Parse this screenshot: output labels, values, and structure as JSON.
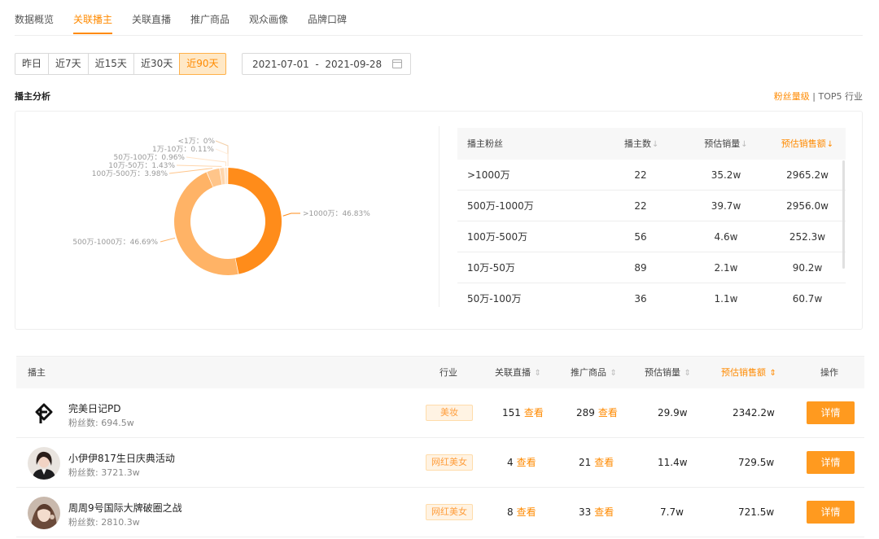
{
  "tabs": [
    "数据概览",
    "关联播主",
    "关联直播",
    "推广商品",
    "观众画像",
    "品牌口碑"
  ],
  "date_range": {
    "buttons": [
      "昨日",
      "近7天",
      "近15天",
      "近30天",
      "近90天"
    ],
    "active": "近90天",
    "start": "2021-07-01",
    "separator": "-",
    "end": "2021-09-28"
  },
  "analysis": {
    "title": "播主分析",
    "toggle_fans": "粉丝量级",
    "toggle_sep": " | ",
    "toggle_top5": "TOP5 行业"
  },
  "chart_data": {
    "type": "pie",
    "title": "",
    "labels": [
      "<1万",
      "1万-10万",
      "50万-100万",
      "10万-50万",
      "100万-500万",
      ">1000万",
      "500万-1000万"
    ],
    "values": [
      0,
      0.11,
      0.96,
      1.43,
      3.98,
      46.83,
      46.69
    ],
    "label_text": [
      "<1万：0%",
      "1万-10万：0.11%",
      "50万-100万：0.96%",
      "10万-50万：1.43%",
      "100万-500万：3.98%",
      ">1000万：46.83%",
      "500万-1000万：46.69%"
    ],
    "colors": {
      ">1000万": "#ff8c1a",
      "500万-1000万": "#ffb366",
      "100万-500万": "#ffc58a",
      "10万-50万": "#ffd6ad",
      "50万-100万": "#ffe3c7",
      "1万-10万": "#ffeedd",
      "<1万": "#fff6ee"
    }
  },
  "fans_table": {
    "headers": [
      "播主粉丝",
      "播主数",
      "预估销量",
      "预估销售额"
    ],
    "sort_arrow": "↓",
    "rows": [
      [
        ">1000万",
        "22",
        "35.2w",
        "2965.2w"
      ],
      [
        "500万-1000万",
        "22",
        "39.7w",
        "2956.0w"
      ],
      [
        "100万-500万",
        "56",
        "4.6w",
        "252.3w"
      ],
      [
        "10万-50万",
        "89",
        "2.1w",
        "90.2w"
      ],
      [
        "50万-100万",
        "36",
        "1.1w",
        "60.7w"
      ]
    ]
  },
  "anchor_table": {
    "headers": {
      "anchor": "播主",
      "industry": "行业",
      "live": "关联直播",
      "goods": "推广商品",
      "sales": "预估销量",
      "revenue": "预估销售额",
      "action": "操作"
    },
    "sort_icon": "⇕",
    "view_label": "查看",
    "detail_label": "详情",
    "fans_prefix": "粉丝数: ",
    "rows": [
      {
        "name": "完美日记PD",
        "fans": "694.5w",
        "industry": "美妆",
        "live": "151",
        "goods": "289",
        "sales": "29.9w",
        "revenue": "2342.2w"
      },
      {
        "name": "小伊伊817生日庆典活动",
        "fans": "3721.3w",
        "industry": "网红美女",
        "live": "4",
        "goods": "21",
        "sales": "11.4w",
        "revenue": "729.5w"
      },
      {
        "name": "周周9号国际大牌破圈之战",
        "fans": "2810.3w",
        "industry": "网红美女",
        "live": "8",
        "goods": "33",
        "sales": "7.7w",
        "revenue": "721.5w"
      }
    ]
  }
}
